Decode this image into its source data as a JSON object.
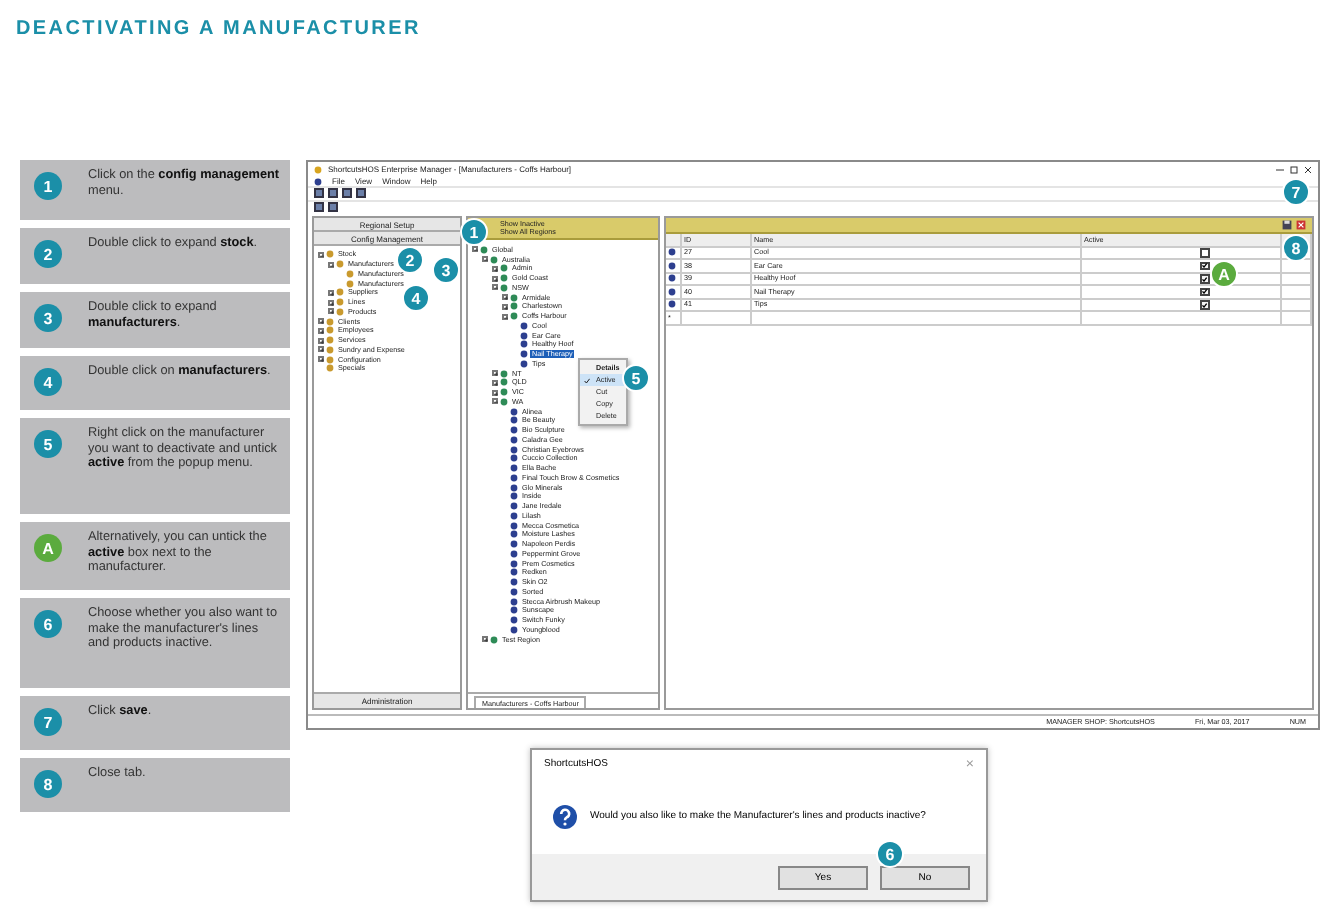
{
  "title": "DEACTIVATING A MANUFACTURER",
  "steps": [
    {
      "badge": "1",
      "color": "#1b8fa8",
      "text": "Click on the **config management** menu."
    },
    {
      "badge": "2",
      "color": "#1b8fa8",
      "text": "Double click to expand **stock**."
    },
    {
      "badge": "3",
      "color": "#1b8fa8",
      "text": "Double click to expand **manufacturers**."
    },
    {
      "badge": "4",
      "color": "#1b8fa8",
      "text": "Double click on **manufacturers**."
    },
    {
      "badge": "5",
      "color": "#1b8fa8",
      "text": "Right click on the manufacturer you want to deactivate and untick **active** from the popup menu."
    },
    {
      "badge": "A",
      "color": "#5bab3e",
      "text": "Alternatively, you can untick the **active** box next to the manufacturer."
    },
    {
      "badge": "6",
      "color": "#1b8fa8",
      "text": "Choose whether you also want to make the manufacturer's lines and products inactive."
    },
    {
      "badge": "7",
      "color": "#1b8fa8",
      "text": "Click **save**."
    },
    {
      "badge": "8",
      "color": "#1b8fa8",
      "text": "Close tab."
    }
  ],
  "app": {
    "window_title": "ShortcutsHOS Enterprise Manager - [Manufacturers - Coffs Harbour]",
    "menu": [
      "File",
      "View",
      "Window",
      "Help"
    ],
    "left_panel": {
      "buttons": [
        "Regional Setup",
        "Config Management"
      ],
      "tree": [
        {
          "label": "Stock",
          "expanded": true,
          "children": [
            {
              "label": "Manufacturers",
              "expanded": true,
              "children": [
                {
                  "label": "Manufacturers"
                },
                {
                  "label": "Manufacturers"
                }
              ]
            },
            {
              "label": "Suppliers",
              "expanded": false
            },
            {
              "label": "Lines",
              "expanded": false
            },
            {
              "label": "Products",
              "expanded": false
            }
          ]
        },
        {
          "label": "Clients",
          "expanded": false
        },
        {
          "label": "Employees",
          "expanded": false
        },
        {
          "label": "Services",
          "expanded": false
        },
        {
          "label": "Sundry and Expense",
          "expanded": false
        },
        {
          "label": "Configuration",
          "expanded": false
        },
        {
          "label": "Specials"
        }
      ],
      "footer": "Administration"
    },
    "middle_panel": {
      "toolbar": [
        "Show Inactive",
        "Show All Regions"
      ],
      "tree": [
        {
          "label": "Global",
          "expanded": true,
          "selected": false,
          "children": [
            {
              "label": "Australia",
              "expanded": true,
              "selected": false,
              "children": [
                {
                  "label": "Admin",
                  "expanded": false,
                  "selected": false
                },
                {
                  "label": "Gold Coast",
                  "expanded": false,
                  "selected": false
                },
                {
                  "label": "NSW",
                  "expanded": true,
                  "selected": false,
                  "children": [
                    {
                      "label": "Armidale",
                      "expanded": false,
                      "selected": false
                    },
                    {
                      "label": "Charlestown",
                      "expanded": false,
                      "selected": false
                    },
                    {
                      "label": "Coffs Harbour",
                      "expanded": true,
                      "selected": false,
                      "children": [
                        {
                          "label": "Cool",
                          "selected": false
                        },
                        {
                          "label": "Ear Care",
                          "selected": false
                        },
                        {
                          "label": "Healthy Hoof",
                          "selected": false
                        },
                        {
                          "label": "Nail Therapy",
                          "selected": true
                        },
                        {
                          "label": "Tips",
                          "selected": false
                        }
                      ]
                    }
                  ]
                },
                {
                  "label": "NT",
                  "expanded": false,
                  "selected": false
                },
                {
                  "label": "QLD",
                  "expanded": false,
                  "selected": false
                },
                {
                  "label": "VIC",
                  "expanded": false,
                  "selected": false
                },
                {
                  "label": "WA",
                  "expanded": true,
                  "selected": false,
                  "children": [
                    {
                      "label": "Alinea",
                      "selected": false
                    },
                    {
                      "label": "Be Beauty",
                      "selected": false
                    },
                    {
                      "label": "Bio Sculpture",
                      "selected": false
                    },
                    {
                      "label": "Caladra Gee",
                      "selected": false
                    },
                    {
                      "label": "Christian Eyebrows",
                      "selected": false
                    },
                    {
                      "label": "Cuccio Collection",
                      "selected": false
                    },
                    {
                      "label": "Ella Bache",
                      "selected": false
                    },
                    {
                      "label": "Final Touch Brow & Cosmetics",
                      "selected": false
                    },
                    {
                      "label": "Glo Minerals",
                      "selected": false
                    },
                    {
                      "label": "Inside",
                      "selected": false
                    },
                    {
                      "label": "Jane Iredale",
                      "selected": false
                    },
                    {
                      "label": "Lilash",
                      "selected": false
                    },
                    {
                      "label": "Mecca Cosmetica",
                      "selected": false
                    },
                    {
                      "label": "Moisture Lashes",
                      "selected": false
                    },
                    {
                      "label": "Napoleon Perdis",
                      "selected": false
                    },
                    {
                      "label": "Peppermint Grove",
                      "selected": false
                    },
                    {
                      "label": "Prem Cosmetics",
                      "selected": false
                    },
                    {
                      "label": "Redken",
                      "selected": false
                    },
                    {
                      "label": "Skin O2",
                      "selected": false
                    },
                    {
                      "label": "Sorted",
                      "selected": false
                    },
                    {
                      "label": "Stecca Airbrush Makeup",
                      "selected": false
                    },
                    {
                      "label": "Sunscape",
                      "selected": false
                    },
                    {
                      "label": "Switch Funky",
                      "selected": false
                    },
                    {
                      "label": "Youngblood",
                      "selected": false
                    }
                  ]
                }
              ]
            },
            {
              "label": "Test Region",
              "expanded": false,
              "selected": false
            }
          ]
        }
      ],
      "context_menu": [
        {
          "label": "Details",
          "kind": "header",
          "checked": false,
          "selected": false
        },
        {
          "label": "Active",
          "kind": "item",
          "checked": true,
          "selected": true
        },
        {
          "label": "Cut",
          "kind": "item",
          "checked": false,
          "selected": false
        },
        {
          "label": "Copy",
          "kind": "item",
          "checked": false,
          "selected": false
        },
        {
          "label": "Delete",
          "kind": "item",
          "checked": false,
          "selected": false
        }
      ],
      "tab": "Manufacturers - Coffs Harbour"
    },
    "grid": {
      "columns": [
        "ID",
        "Name",
        "Active"
      ],
      "rows": [
        {
          "id": "27",
          "name": "Cool",
          "active": false
        },
        {
          "id": "38",
          "name": "Ear Care",
          "active": true
        },
        {
          "id": "39",
          "name": "Healthy Hoof",
          "active": true
        },
        {
          "id": "40",
          "name": "Nail Therapy",
          "active": true
        },
        {
          "id": "41",
          "name": "Tips",
          "active": true
        }
      ],
      "new_row_marker": "*"
    },
    "status_bar": [
      "MANAGER SHOP: ShortcutsHOS",
      "Fri, Mar 03, 2017",
      "NUM"
    ]
  },
  "dialog": {
    "title": "ShortcutsHOS",
    "close": "×",
    "message": "Would you also like to make the Manufacturer's lines and products inactive?",
    "buttons": [
      "Yes",
      "No"
    ]
  },
  "callouts": [
    {
      "label": "1",
      "color": "#1b8fa8"
    },
    {
      "label": "2",
      "color": "#1b8fa8"
    },
    {
      "label": "3",
      "color": "#1b8fa8"
    },
    {
      "label": "4",
      "color": "#1b8fa8"
    },
    {
      "label": "5",
      "color": "#1b8fa8"
    },
    {
      "label": "A",
      "color": "#5bab3e"
    },
    {
      "label": "6",
      "color": "#1b8fa8"
    },
    {
      "label": "7",
      "color": "#1b8fa8"
    },
    {
      "label": "8",
      "color": "#1b8fa8"
    }
  ]
}
